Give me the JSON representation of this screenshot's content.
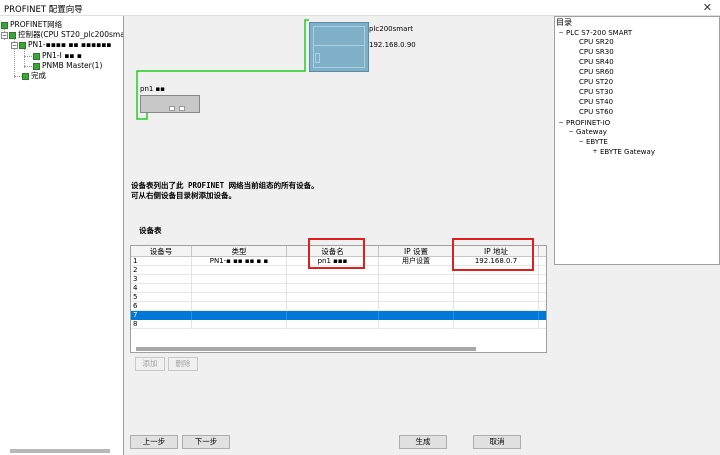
{
  "window": {
    "title": "PROFINET 配置向导",
    "close_glyph": "✕"
  },
  "left_tree": {
    "root": "PROFINET网络",
    "controller": "控制器(CPU ST20_plc200smart)",
    "device": "PN1-▪▪▪▪ ▪▪ ▪▪▪▪▪▪",
    "device_child1": "PN1-I ▪▪ ▪",
    "device_child2": "PNMB Master(1)",
    "finish": "完成"
  },
  "canvas": {
    "plc_name": "plc200smart",
    "plc_ip": "192.168.0.90",
    "device_name": "pn1 ▪▪"
  },
  "description": {
    "line1": "设备表列出了此 PROFINET 网络当前组态的所有设备。",
    "line2": "可从右侧设备目录树添加设备。"
  },
  "device_table": {
    "title": "设备表",
    "columns": [
      "设备号",
      "类型",
      "设备名",
      "IP 设置",
      "IP 地址"
    ],
    "rows": [
      {
        "no": "1",
        "type": "PN1-▪ ▪▪ ▪▪ ▪ ▪",
        "name": "pn1 ▪▪▪",
        "ip_setting": "用户设置",
        "ip": "192.168.0.7"
      },
      {
        "no": "2",
        "type": "",
        "name": "",
        "ip_setting": "",
        "ip": ""
      },
      {
        "no": "3",
        "type": "",
        "name": "",
        "ip_setting": "",
        "ip": ""
      },
      {
        "no": "4",
        "type": "",
        "name": "",
        "ip_setting": "",
        "ip": ""
      },
      {
        "no": "5",
        "type": "",
        "name": "",
        "ip_setting": "",
        "ip": ""
      },
      {
        "no": "6",
        "type": "",
        "name": "",
        "ip_setting": "",
        "ip": ""
      },
      {
        "no": "7",
        "type": "",
        "name": "",
        "ip_setting": "",
        "ip": ""
      },
      {
        "no": "8",
        "type": "",
        "name": "",
        "ip_setting": "",
        "ip": ""
      }
    ],
    "selected_row": 7
  },
  "buttons": {
    "add": "添加",
    "delete": "删除",
    "prev": "上一步",
    "next": "下一步",
    "generate": "生成",
    "cancel": "取消"
  },
  "catalog": {
    "title": "目录",
    "plc_group": "PLC S7-200 SMART",
    "cpus": [
      "CPU SR20",
      "CPU SR30",
      "CPU SR40",
      "CPU SR60",
      "CPU ST20",
      "CPU ST30",
      "CPU ST40",
      "CPU ST60"
    ],
    "io_group": "PROFINET-IO",
    "gateway": "Gateway",
    "vendor": "EBYTE",
    "product": "EBYTE Gateway"
  },
  "colors": {
    "selection": "#0078d7",
    "highlight_box": "#e02020",
    "network_line": "#22cc22"
  }
}
